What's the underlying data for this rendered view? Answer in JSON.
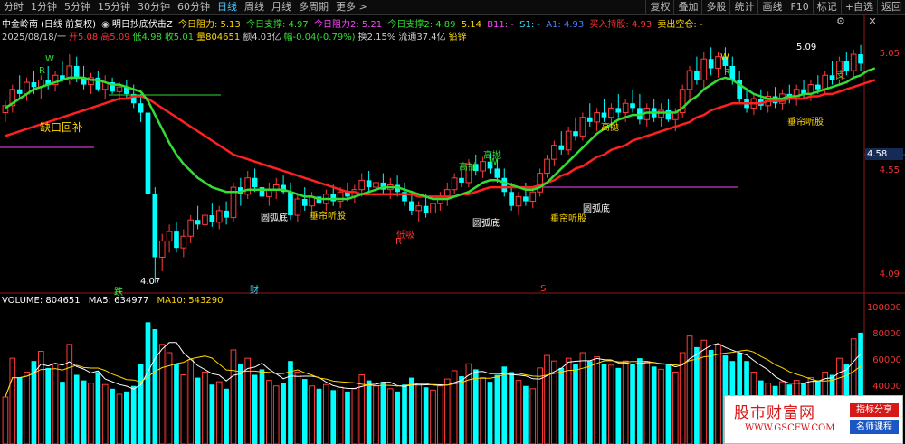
{
  "toolbar": {
    "tabs": [
      "分时",
      "1分钟",
      "5分钟",
      "15分钟",
      "30分钟",
      "60分钟",
      "日线",
      "周线",
      "月线",
      "多周期",
      "更多 >"
    ],
    "active_index": 6,
    "right": [
      "复权",
      "叠加",
      "多股",
      "统计",
      "画线",
      "F10",
      "标记",
      "+自选",
      "返回"
    ]
  },
  "stock": {
    "name": "中金岭南",
    "mode": "(日线 前复权)",
    "indicator": "明日抄底伏击Z",
    "resistance_today": "今日阻力: 5.13",
    "support_today": "今日支撑: 4.97",
    "resistance_2": "今日阻力2: 5.21",
    "support_2": "今日支撑2: 4.89",
    "value_514": "5.14",
    "b11": "B11: -",
    "s1": "S1: -",
    "a1": "A1: 4.93",
    "buy_hold": "买入持股: 4.93",
    "sell_empty": "卖出空仓: -"
  },
  "quote": {
    "date": "2025/08/18/一",
    "open": "开5.08",
    "high": "高5.09",
    "low": "低4.98",
    "close": "收5.01",
    "volume": "量804651",
    "amount": "额4.03亿",
    "change": "幅-0.04(-0.79%)",
    "turnover": "换2.15%",
    "float_value": "流通37.4亿",
    "sector": "铅锌"
  },
  "price_axis": [
    "5.05",
    "4.55",
    "4.09"
  ],
  "current_price": "4.58",
  "volume_axis": [
    "100000",
    "80000",
    "60000",
    "40000"
  ],
  "volume_header": {
    "volume": "VOLUME: 804651",
    "ma5": "MA5: 634977",
    "ma10": "MA10: 543290"
  },
  "annotations": {
    "gap_fill": "缺口回补",
    "round_bottom_1": "圆弧底",
    "curtain_1": "垂帘听股",
    "low_buy": "低吸",
    "round_bottom_2": "圆弧底",
    "curtain_2": "垂帘听股",
    "round_bottom_3": "圆弧底",
    "curtain_3": "垂帘听股",
    "high_sell_1": "高抛",
    "high_sell_2": "高抛",
    "high_sell_3": "高抛",
    "low_price": "4.07",
    "high_price": "5.09",
    "event_drop": "跌",
    "event_finance": "财",
    "event_s": "S",
    "mark_r": "R",
    "mark_w": "W",
    "mark_b": "支"
  },
  "watermark": {
    "title": "股市财富网",
    "url": "WWW.GSCFW.COM",
    "tag1": "指标分享",
    "tag2": "名师课程"
  },
  "chart_data": {
    "type": "candlestick",
    "y_range": [
      4.05,
      5.12
    ],
    "volume_range": [
      0,
      100000
    ],
    "bars": [
      {
        "o": 4.8,
        "h": 4.85,
        "l": 4.76,
        "c": 4.83,
        "v": 34000
      },
      {
        "o": 4.83,
        "h": 4.92,
        "l": 4.8,
        "c": 4.9,
        "v": 62000
      },
      {
        "o": 4.9,
        "h": 4.96,
        "l": 4.86,
        "c": 4.88,
        "v": 48000
      },
      {
        "o": 4.88,
        "h": 4.95,
        "l": 4.85,
        "c": 4.93,
        "v": 52000
      },
      {
        "o": 4.93,
        "h": 4.98,
        "l": 4.88,
        "c": 4.91,
        "v": 60000
      },
      {
        "o": 4.91,
        "h": 4.96,
        "l": 4.86,
        "c": 4.94,
        "v": 67000
      },
      {
        "o": 4.94,
        "h": 5.0,
        "l": 4.9,
        "c": 4.92,
        "v": 55000
      },
      {
        "o": 4.92,
        "h": 4.98,
        "l": 4.89,
        "c": 4.96,
        "v": 58000
      },
      {
        "o": 4.96,
        "h": 5.02,
        "l": 4.93,
        "c": 4.94,
        "v": 45000
      },
      {
        "o": 4.94,
        "h": 5.05,
        "l": 4.92,
        "c": 5.0,
        "v": 72000
      },
      {
        "o": 5.0,
        "h": 5.04,
        "l": 4.93,
        "c": 4.95,
        "v": 50000
      },
      {
        "o": 4.95,
        "h": 5.0,
        "l": 4.9,
        "c": 4.92,
        "v": 46000
      },
      {
        "o": 4.92,
        "h": 4.97,
        "l": 4.88,
        "c": 4.95,
        "v": 44000
      },
      {
        "o": 4.95,
        "h": 4.98,
        "l": 4.89,
        "c": 4.9,
        "v": 52000
      },
      {
        "o": 4.9,
        "h": 4.96,
        "l": 4.86,
        "c": 4.93,
        "v": 43000
      },
      {
        "o": 4.93,
        "h": 4.95,
        "l": 4.88,
        "c": 4.89,
        "v": 40000
      },
      {
        "o": 4.89,
        "h": 4.93,
        "l": 4.85,
        "c": 4.91,
        "v": 36000
      },
      {
        "o": 4.91,
        "h": 4.94,
        "l": 4.86,
        "c": 4.88,
        "v": 38000
      },
      {
        "o": 4.88,
        "h": 4.92,
        "l": 4.82,
        "c": 4.84,
        "v": 42000
      },
      {
        "o": 4.84,
        "h": 4.88,
        "l": 4.76,
        "c": 4.8,
        "v": 58000
      },
      {
        "o": 4.8,
        "h": 4.82,
        "l": 4.4,
        "c": 4.45,
        "v": 88000
      },
      {
        "o": 4.45,
        "h": 4.48,
        "l": 4.07,
        "c": 4.18,
        "v": 83000
      },
      {
        "o": 4.18,
        "h": 4.28,
        "l": 4.12,
        "c": 4.25,
        "v": 72000
      },
      {
        "o": 4.25,
        "h": 4.32,
        "l": 4.2,
        "c": 4.29,
        "v": 66000
      },
      {
        "o": 4.29,
        "h": 4.33,
        "l": 4.2,
        "c": 4.22,
        "v": 58000
      },
      {
        "o": 4.22,
        "h": 4.3,
        "l": 4.18,
        "c": 4.27,
        "v": 50000
      },
      {
        "o": 4.27,
        "h": 4.36,
        "l": 4.24,
        "c": 4.34,
        "v": 61000
      },
      {
        "o": 4.34,
        "h": 4.4,
        "l": 4.3,
        "c": 4.32,
        "v": 48000
      },
      {
        "o": 4.32,
        "h": 4.38,
        "l": 4.28,
        "c": 4.36,
        "v": 52000
      },
      {
        "o": 4.36,
        "h": 4.41,
        "l": 4.31,
        "c": 4.33,
        "v": 43000
      },
      {
        "o": 4.33,
        "h": 4.4,
        "l": 4.3,
        "c": 4.38,
        "v": 45000
      },
      {
        "o": 4.38,
        "h": 4.42,
        "l": 4.32,
        "c": 4.35,
        "v": 40000
      },
      {
        "o": 4.35,
        "h": 4.5,
        "l": 4.33,
        "c": 4.48,
        "v": 68000
      },
      {
        "o": 4.48,
        "h": 4.52,
        "l": 4.4,
        "c": 4.45,
        "v": 58000
      },
      {
        "o": 4.45,
        "h": 4.55,
        "l": 4.43,
        "c": 4.52,
        "v": 62000
      },
      {
        "o": 4.52,
        "h": 4.56,
        "l": 4.46,
        "c": 4.48,
        "v": 50000
      },
      {
        "o": 4.48,
        "h": 4.54,
        "l": 4.42,
        "c": 4.44,
        "v": 54000
      },
      {
        "o": 4.44,
        "h": 4.5,
        "l": 4.4,
        "c": 4.47,
        "v": 46000
      },
      {
        "o": 4.47,
        "h": 4.52,
        "l": 4.43,
        "c": 4.49,
        "v": 42000
      },
      {
        "o": 4.49,
        "h": 4.53,
        "l": 4.45,
        "c": 4.46,
        "v": 44000
      },
      {
        "o": 4.46,
        "h": 4.5,
        "l": 4.34,
        "c": 4.36,
        "v": 60000
      },
      {
        "o": 4.36,
        "h": 4.45,
        "l": 4.33,
        "c": 4.43,
        "v": 52000
      },
      {
        "o": 4.43,
        "h": 4.48,
        "l": 4.38,
        "c": 4.4,
        "v": 47000
      },
      {
        "o": 4.4,
        "h": 4.46,
        "l": 4.37,
        "c": 4.44,
        "v": 42000
      },
      {
        "o": 4.44,
        "h": 4.48,
        "l": 4.39,
        "c": 4.41,
        "v": 40000
      },
      {
        "o": 4.41,
        "h": 4.47,
        "l": 4.38,
        "c": 4.45,
        "v": 43000
      },
      {
        "o": 4.45,
        "h": 4.49,
        "l": 4.4,
        "c": 4.42,
        "v": 39000
      },
      {
        "o": 4.42,
        "h": 4.48,
        "l": 4.39,
        "c": 4.46,
        "v": 41000
      },
      {
        "o": 4.46,
        "h": 4.5,
        "l": 4.42,
        "c": 4.44,
        "v": 38000
      },
      {
        "o": 4.44,
        "h": 4.49,
        "l": 4.41,
        "c": 4.47,
        "v": 40000
      },
      {
        "o": 4.47,
        "h": 4.54,
        "l": 4.44,
        "c": 4.51,
        "v": 50000
      },
      {
        "o": 4.51,
        "h": 4.55,
        "l": 4.46,
        "c": 4.48,
        "v": 46000
      },
      {
        "o": 4.48,
        "h": 4.53,
        "l": 4.44,
        "c": 4.5,
        "v": 42000
      },
      {
        "o": 4.5,
        "h": 4.54,
        "l": 4.45,
        "c": 4.47,
        "v": 45000
      },
      {
        "o": 4.47,
        "h": 4.52,
        "l": 4.43,
        "c": 4.49,
        "v": 40000
      },
      {
        "o": 4.49,
        "h": 4.53,
        "l": 4.44,
        "c": 4.46,
        "v": 38000
      },
      {
        "o": 4.46,
        "h": 4.5,
        "l": 4.4,
        "c": 4.42,
        "v": 43000
      },
      {
        "o": 4.42,
        "h": 4.46,
        "l": 4.36,
        "c": 4.38,
        "v": 48000
      },
      {
        "o": 4.38,
        "h": 4.42,
        "l": 4.33,
        "c": 4.4,
        "v": 44000
      },
      {
        "o": 4.4,
        "h": 4.45,
        "l": 4.35,
        "c": 4.37,
        "v": 41000
      },
      {
        "o": 4.37,
        "h": 4.43,
        "l": 4.34,
        "c": 4.41,
        "v": 39000
      },
      {
        "o": 4.41,
        "h": 4.46,
        "l": 4.38,
        "c": 4.44,
        "v": 42000
      },
      {
        "o": 4.44,
        "h": 4.5,
        "l": 4.4,
        "c": 4.47,
        "v": 47000
      },
      {
        "o": 4.47,
        "h": 4.54,
        "l": 4.45,
        "c": 4.52,
        "v": 53000
      },
      {
        "o": 4.52,
        "h": 4.58,
        "l": 4.48,
        "c": 4.5,
        "v": 49000
      },
      {
        "o": 4.5,
        "h": 4.6,
        "l": 4.48,
        "c": 4.58,
        "v": 58000
      },
      {
        "o": 4.58,
        "h": 4.62,
        "l": 4.53,
        "c": 4.55,
        "v": 54000
      },
      {
        "o": 4.55,
        "h": 4.61,
        "l": 4.52,
        "c": 4.59,
        "v": 48000
      },
      {
        "o": 4.59,
        "h": 4.63,
        "l": 4.54,
        "c": 4.56,
        "v": 45000
      },
      {
        "o": 4.56,
        "h": 4.6,
        "l": 4.5,
        "c": 4.52,
        "v": 50000
      },
      {
        "o": 4.52,
        "h": 4.56,
        "l": 4.44,
        "c": 4.46,
        "v": 56000
      },
      {
        "o": 4.46,
        "h": 4.5,
        "l": 4.38,
        "c": 4.4,
        "v": 52000
      },
      {
        "o": 4.4,
        "h": 4.46,
        "l": 4.36,
        "c": 4.44,
        "v": 46000
      },
      {
        "o": 4.44,
        "h": 4.5,
        "l": 4.4,
        "c": 4.42,
        "v": 42000
      },
      {
        "o": 4.42,
        "h": 4.48,
        "l": 4.39,
        "c": 4.46,
        "v": 40000
      },
      {
        "o": 4.46,
        "h": 4.56,
        "l": 4.44,
        "c": 4.54,
        "v": 55000
      },
      {
        "o": 4.54,
        "h": 4.62,
        "l": 4.52,
        "c": 4.6,
        "v": 64000
      },
      {
        "o": 4.6,
        "h": 4.68,
        "l": 4.57,
        "c": 4.66,
        "v": 60000
      },
      {
        "o": 4.66,
        "h": 4.72,
        "l": 4.62,
        "c": 4.64,
        "v": 55000
      },
      {
        "o": 4.64,
        "h": 4.74,
        "l": 4.62,
        "c": 4.72,
        "v": 62000
      },
      {
        "o": 4.72,
        "h": 4.78,
        "l": 4.68,
        "c": 4.7,
        "v": 58000
      },
      {
        "o": 4.7,
        "h": 4.8,
        "l": 4.68,
        "c": 4.78,
        "v": 66000
      },
      {
        "o": 4.78,
        "h": 4.84,
        "l": 4.74,
        "c": 4.76,
        "v": 60000
      },
      {
        "o": 4.76,
        "h": 4.82,
        "l": 4.72,
        "c": 4.8,
        "v": 63000
      },
      {
        "o": 4.8,
        "h": 4.86,
        "l": 4.76,
        "c": 4.78,
        "v": 58000
      },
      {
        "o": 4.78,
        "h": 4.84,
        "l": 4.74,
        "c": 4.82,
        "v": 57000
      },
      {
        "o": 4.82,
        "h": 4.88,
        "l": 4.78,
        "c": 4.8,
        "v": 55000
      },
      {
        "o": 4.8,
        "h": 4.86,
        "l": 4.76,
        "c": 4.84,
        "v": 60000
      },
      {
        "o": 4.84,
        "h": 4.9,
        "l": 4.8,
        "c": 4.82,
        "v": 58000
      },
      {
        "o": 4.82,
        "h": 4.88,
        "l": 4.75,
        "c": 4.77,
        "v": 62000
      },
      {
        "o": 4.77,
        "h": 4.84,
        "l": 4.74,
        "c": 4.82,
        "v": 59000
      },
      {
        "o": 4.82,
        "h": 4.86,
        "l": 4.76,
        "c": 4.78,
        "v": 56000
      },
      {
        "o": 4.78,
        "h": 4.84,
        "l": 4.74,
        "c": 4.81,
        "v": 54000
      },
      {
        "o": 4.81,
        "h": 4.86,
        "l": 4.76,
        "c": 4.77,
        "v": 58000
      },
      {
        "o": 4.77,
        "h": 4.82,
        "l": 4.72,
        "c": 4.8,
        "v": 52000
      },
      {
        "o": 4.8,
        "h": 4.92,
        "l": 4.78,
        "c": 4.9,
        "v": 66000
      },
      {
        "o": 4.9,
        "h": 5.0,
        "l": 4.86,
        "c": 4.98,
        "v": 78000
      },
      {
        "o": 4.98,
        "h": 5.04,
        "l": 4.92,
        "c": 4.94,
        "v": 70000
      },
      {
        "o": 4.94,
        "h": 5.06,
        "l": 4.9,
        "c": 5.03,
        "v": 75000
      },
      {
        "o": 5.03,
        "h": 5.08,
        "l": 4.96,
        "c": 4.99,
        "v": 68000
      },
      {
        "o": 4.99,
        "h": 5.06,
        "l": 4.95,
        "c": 5.04,
        "v": 72000
      },
      {
        "o": 5.04,
        "h": 5.08,
        "l": 4.98,
        "c": 5.0,
        "v": 64000
      },
      {
        "o": 5.0,
        "h": 5.04,
        "l": 4.92,
        "c": 4.94,
        "v": 60000
      },
      {
        "o": 4.94,
        "h": 4.98,
        "l": 4.84,
        "c": 4.86,
        "v": 66000
      },
      {
        "o": 4.86,
        "h": 4.9,
        "l": 4.8,
        "c": 4.82,
        "v": 60000
      },
      {
        "o": 4.82,
        "h": 4.88,
        "l": 4.79,
        "c": 4.86,
        "v": 52000
      },
      {
        "o": 4.86,
        "h": 4.9,
        "l": 4.81,
        "c": 4.83,
        "v": 46000
      },
      {
        "o": 4.83,
        "h": 4.89,
        "l": 4.8,
        "c": 4.87,
        "v": 44000
      },
      {
        "o": 4.87,
        "h": 4.91,
        "l": 4.82,
        "c": 4.84,
        "v": 42000
      },
      {
        "o": 4.84,
        "h": 4.9,
        "l": 4.81,
        "c": 4.88,
        "v": 45000
      },
      {
        "o": 4.88,
        "h": 4.92,
        "l": 4.84,
        "c": 4.86,
        "v": 43000
      },
      {
        "o": 4.86,
        "h": 4.92,
        "l": 4.83,
        "c": 4.9,
        "v": 46000
      },
      {
        "o": 4.9,
        "h": 4.94,
        "l": 4.86,
        "c": 4.88,
        "v": 44000
      },
      {
        "o": 4.88,
        "h": 4.94,
        "l": 4.85,
        "c": 4.92,
        "v": 48000
      },
      {
        "o": 4.92,
        "h": 4.96,
        "l": 4.88,
        "c": 4.9,
        "v": 46000
      },
      {
        "o": 4.9,
        "h": 4.98,
        "l": 4.88,
        "c": 4.96,
        "v": 52000
      },
      {
        "o": 4.96,
        "h": 5.02,
        "l": 4.92,
        "c": 4.94,
        "v": 50000
      },
      {
        "o": 4.94,
        "h": 5.04,
        "l": 4.92,
        "c": 5.02,
        "v": 62000
      },
      {
        "o": 5.02,
        "h": 5.06,
        "l": 4.96,
        "c": 4.98,
        "v": 58000
      },
      {
        "o": 4.98,
        "h": 5.07,
        "l": 4.95,
        "c": 5.05,
        "v": 76000
      },
      {
        "o": 5.05,
        "h": 5.09,
        "l": 4.98,
        "c": 5.01,
        "v": 80465
      }
    ],
    "ma_short": [
      4.82,
      4.84,
      4.86,
      4.88,
      4.9,
      4.91,
      4.92,
      4.93,
      4.94,
      4.95,
      4.95,
      4.95,
      4.94,
      4.94,
      4.93,
      4.92,
      4.92,
      4.91,
      4.9,
      4.89,
      4.85,
      4.79,
      4.73,
      4.67,
      4.62,
      4.58,
      4.55,
      4.52,
      4.5,
      4.48,
      4.47,
      4.46,
      4.46,
      4.46,
      4.47,
      4.47,
      4.47,
      4.47,
      4.47,
      4.47,
      4.46,
      4.45,
      4.44,
      4.44,
      4.43,
      4.43,
      4.43,
      4.43,
      4.43,
      4.44,
      4.45,
      4.46,
      4.47,
      4.48,
      4.48,
      4.48,
      4.47,
      4.46,
      4.45,
      4.44,
      4.43,
      4.43,
      4.43,
      4.44,
      4.45,
      4.46,
      4.48,
      4.5,
      4.51,
      4.51,
      4.5,
      4.49,
      4.48,
      4.47,
      4.47,
      4.48,
      4.5,
      4.53,
      4.56,
      4.59,
      4.62,
      4.65,
      4.68,
      4.71,
      4.73,
      4.75,
      4.77,
      4.78,
      4.79,
      4.79,
      4.8,
      4.8,
      4.8,
      4.8,
      4.8,
      4.82,
      4.85,
      4.87,
      4.9,
      4.92,
      4.94,
      4.95,
      4.94,
      4.92,
      4.9,
      4.88,
      4.87,
      4.86,
      4.86,
      4.86,
      4.87,
      4.87,
      4.88,
      4.88,
      4.89,
      4.9,
      4.91,
      4.92,
      4.93,
      4.95,
      4.96,
      4.98,
      4.99
    ],
    "ma_long": [
      4.7,
      4.71,
      4.72,
      4.73,
      4.74,
      4.75,
      4.76,
      4.77,
      4.78,
      4.79,
      4.8,
      4.81,
      4.82,
      4.83,
      4.84,
      4.85,
      4.86,
      4.86,
      4.87,
      4.87,
      4.86,
      4.84,
      4.82,
      4.8,
      4.78,
      4.76,
      4.74,
      4.72,
      4.7,
      4.68,
      4.66,
      4.64,
      4.62,
      4.61,
      4.6,
      4.59,
      4.58,
      4.57,
      4.56,
      4.55,
      4.54,
      4.53,
      4.52,
      4.51,
      4.5,
      4.49,
      4.48,
      4.47,
      4.46,
      4.46,
      4.45,
      4.45,
      4.45,
      4.45,
      4.45,
      4.45,
      4.45,
      4.45,
      4.44,
      4.44,
      4.44,
      4.44,
      4.44,
      4.44,
      4.45,
      4.45,
      4.46,
      4.47,
      4.48,
      4.48,
      4.48,
      4.48,
      4.48,
      4.48,
      4.48,
      4.49,
      4.5,
      4.51,
      4.53,
      4.54,
      4.56,
      4.57,
      4.59,
      4.61,
      4.62,
      4.64,
      4.65,
      4.66,
      4.68,
      4.69,
      4.7,
      4.71,
      4.72,
      4.73,
      4.74,
      4.75,
      4.76,
      4.78,
      4.79,
      4.81,
      4.82,
      4.83,
      4.84,
      4.84,
      4.84,
      4.84,
      4.84,
      4.85,
      4.85,
      4.85,
      4.86,
      4.86,
      4.86,
      4.87,
      4.87,
      4.88,
      4.88,
      4.89,
      4.9,
      4.91,
      4.92,
      4.93,
      4.94
    ],
    "vol_ma5_range_note": ""
  },
  "colors": {
    "up": "#ff3b3b",
    "down": "#00ffff",
    "ma_short": "#33dd33",
    "ma_long": "#ff2020",
    "axis_text": "#ff3333",
    "yellow": "#ffd700",
    "magenta": "#ff44ff",
    "cyan_text": "#33ddff",
    "label_green": "#33dd33"
  }
}
